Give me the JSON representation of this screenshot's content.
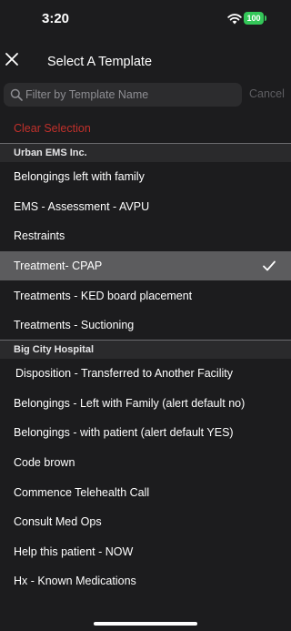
{
  "status_bar": {
    "time": "3:20",
    "battery": "100",
    "wifi_icon": "wifi-icon",
    "battery_color": "#34c759"
  },
  "header": {
    "title": "Select A Template",
    "close_icon": "close-icon"
  },
  "search": {
    "placeholder": "Filter by Template Name",
    "value": "",
    "cancel_label": "Cancel",
    "icon": "search-icon"
  },
  "clear_selection": {
    "label": "Clear Selection",
    "color": "#c0302b"
  },
  "sections": [
    {
      "title": "Urban EMS Inc.",
      "items": [
        {
          "label": "Belongings left with family",
          "selected": false
        },
        {
          "label": "EMS - Assessment - AVPU",
          "selected": false
        },
        {
          "label": "Restraints",
          "selected": false
        },
        {
          "label": "Treatment- CPAP",
          "selected": true
        },
        {
          "label": "Treatments - KED board placement",
          "selected": false
        },
        {
          "label": "Treatments - Suctioning",
          "selected": false
        }
      ]
    },
    {
      "title": "Big City Hospital",
      "items": [
        {
          "label": "Disposition - Transferred to Another Facility",
          "selected": false
        },
        {
          "label": "Belongings - Left with Family (alert default no)",
          "selected": false
        },
        {
          "label": "Belongings - with patient (alert default YES)",
          "selected": false
        },
        {
          "label": "Code brown",
          "selected": false
        },
        {
          "label": "Commence Telehealth Call",
          "selected": false
        },
        {
          "label": "Consult Med Ops",
          "selected": false
        },
        {
          "label": "Help this patient - NOW",
          "selected": false
        },
        {
          "label": "Hx - Known Medications",
          "selected": false
        }
      ]
    }
  ],
  "selected_check_icon": "checkmark-icon",
  "colors": {
    "background": "#1c1c1e",
    "selected_row": "#5c5c5e",
    "section_header": "#2a2a2c"
  }
}
